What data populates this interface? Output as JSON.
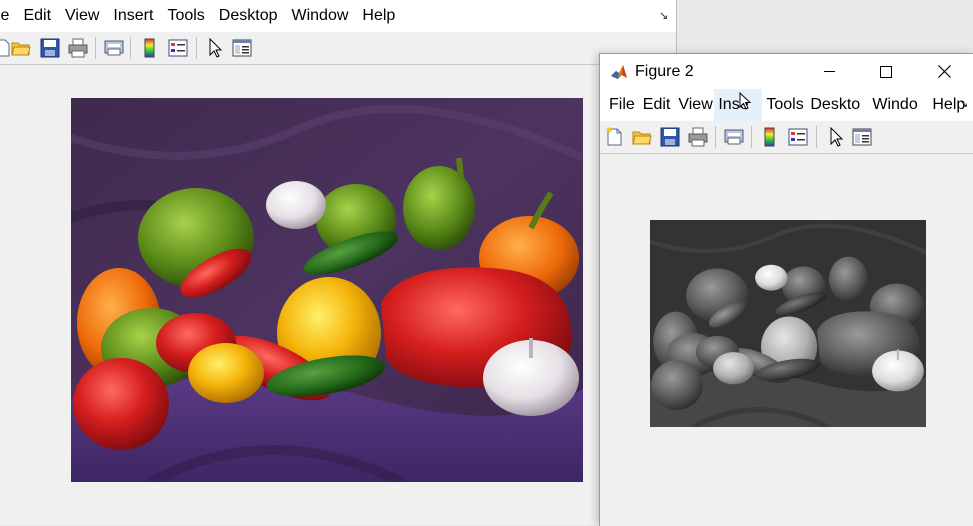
{
  "figure1": {
    "menu": [
      "le",
      "Edit",
      "View",
      "Insert",
      "Tools",
      "Desktop",
      "Window",
      "Help"
    ],
    "toolbar_icons": [
      "open-icon",
      "save-icon",
      "print-icon",
      "print-preview-icon",
      "colorbar-icon",
      "legend-icon",
      "pointer-icon",
      "property-editor-icon"
    ],
    "image": {
      "description_hidden": "",
      "name": "peppers-color-image"
    }
  },
  "figure2": {
    "title": "Figure 2",
    "menu": [
      "File",
      "Edit",
      "View",
      "Inse",
      "Tools",
      "Deskto",
      "Windo",
      "Help"
    ],
    "hovered_menu": "Inse",
    "toolbar_icons": [
      "new-figure-icon",
      "open-icon",
      "save-icon",
      "print-icon",
      "print-preview-icon",
      "colorbar-icon",
      "legend-icon",
      "pointer-icon",
      "property-editor-icon"
    ],
    "window_controls": [
      "minimize",
      "maximize",
      "close"
    ]
  },
  "colors": {
    "matlab_accent": "#e8751a",
    "menubar_bg": "#ffffff",
    "figure_bg": "#f0f0f0",
    "hover_bg": "#e5f0fb"
  }
}
